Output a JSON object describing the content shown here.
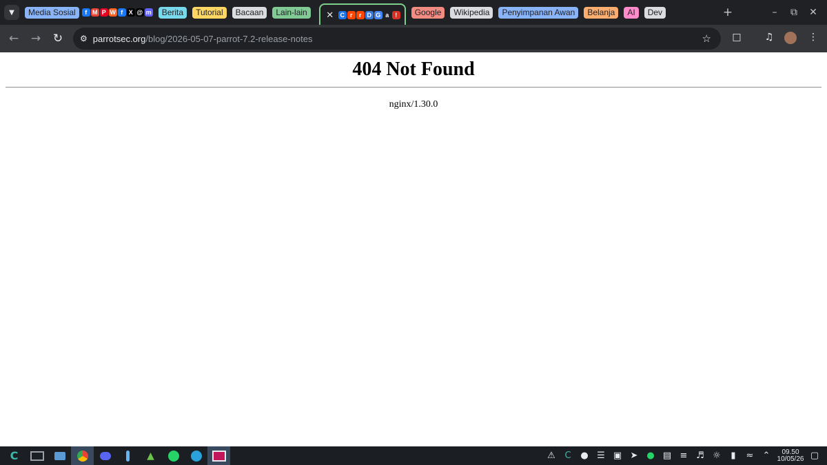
{
  "tab_groups": [
    {
      "label": "Media Sosial",
      "color": "#8ab4f8"
    },
    {
      "label": "Berita",
      "color": "#78d9ec"
    },
    {
      "label": "Tutorial",
      "color": "#fdd663"
    },
    {
      "label": "Bacaan",
      "color": "#dadce0"
    },
    {
      "label": "Lain-lain",
      "color": "#81c995"
    },
    {
      "label": "Google",
      "color": "#f28b82"
    },
    {
      "label": "Wikipedia",
      "color": "#dadce0"
    },
    {
      "label": "Penyimpanan Awan",
      "color": "#8ab4f8"
    },
    {
      "label": "Belanja",
      "color": "#fcad70"
    },
    {
      "label": "AI",
      "color": "#ff8bcb"
    },
    {
      "label": "Dev",
      "color": "#dadce0"
    }
  ],
  "social_favicons": [
    {
      "name": "facebook-icon",
      "glyph": "f",
      "color": "#1877f2"
    },
    {
      "name": "gmail-icon",
      "glyph": "M",
      "color": "#ea4335"
    },
    {
      "name": "pinterest-icon",
      "glyph": "P",
      "color": "#e60023"
    },
    {
      "name": "wattpad-icon",
      "glyph": "W",
      "color": "#ff6122"
    },
    {
      "name": "facebook-icon",
      "glyph": "f",
      "color": "#1877f2"
    },
    {
      "name": "x-icon",
      "glyph": "X",
      "color": "#000000"
    },
    {
      "name": "threads-icon",
      "glyph": "@",
      "color": "#000000"
    },
    {
      "name": "mastodon-icon",
      "glyph": "m",
      "color": "#6364ff"
    }
  ],
  "group_favicons": [
    {
      "name": "cinnamon-icon",
      "glyph": "C",
      "color": "#1a73e8"
    },
    {
      "name": "reddit-icon",
      "glyph": "r",
      "color": "#ff4500"
    },
    {
      "name": "reddit-icon",
      "glyph": "r",
      "color": "#ff4500"
    },
    {
      "name": "d-icon",
      "glyph": "D",
      "color": "#3c78d8"
    },
    {
      "name": "globe-icon",
      "glyph": "G",
      "color": "#4285f4"
    },
    {
      "name": "app-icon",
      "glyph": "a",
      "color": "#202124"
    },
    {
      "name": "alert-icon",
      "glyph": "!",
      "color": "#d93025"
    }
  ],
  "address_bar": {
    "host": "parrotsec.org",
    "path": "/blog/2026-05-07-parrot-7.2-release-notes"
  },
  "page": {
    "heading": "404 Not Found",
    "server": "nginx/1.30.0"
  },
  "taskbar": {
    "time": "09.50",
    "date": "10/05/26"
  }
}
